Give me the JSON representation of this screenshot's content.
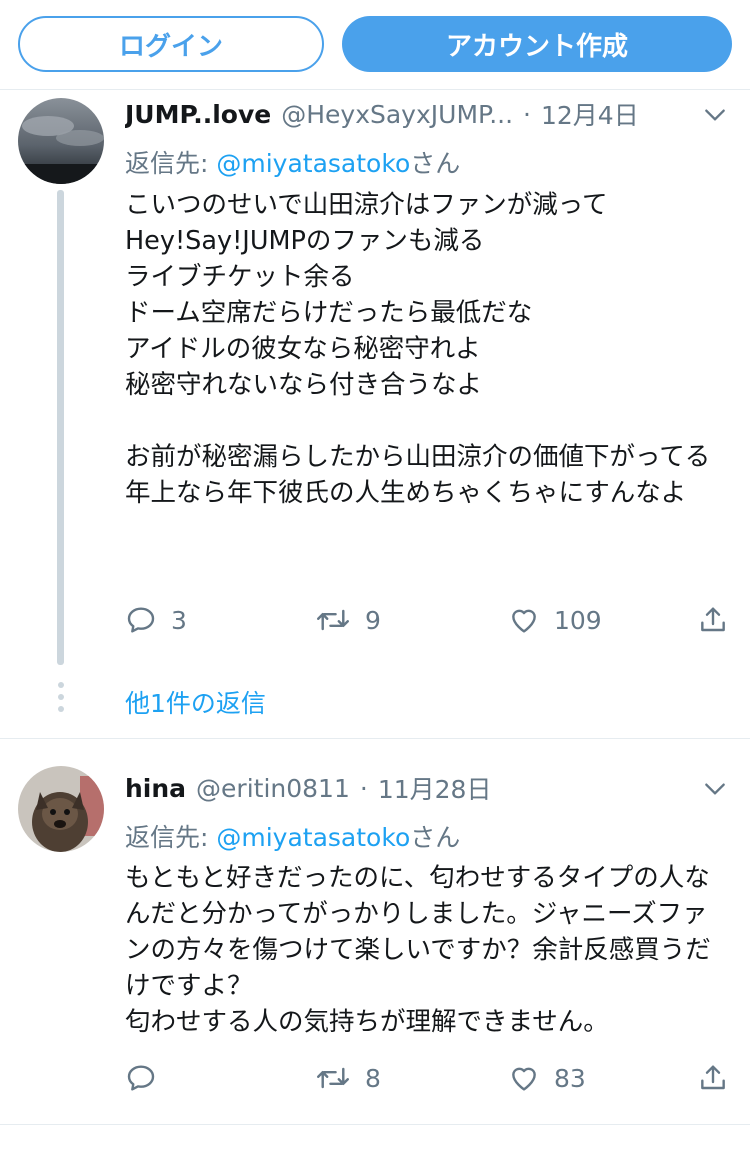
{
  "auth": {
    "login_label": "ログイン",
    "signup_label": "アカウント作成"
  },
  "tweets": [
    {
      "name": "JUMP..love",
      "handle": "@HeyxSayxJUMP...",
      "separator": "·",
      "date": "12月4日",
      "reply_prefix": "返信先: ",
      "reply_mention": "@miyatasatoko",
      "reply_suffix": "さん",
      "text": "こいつのせいで山田涼介はファンが減って\nHey!Say!JUMPのファンも減る\nライブチケット余る\nドーム空席だらけだったら最低だな\nアイドルの彼女なら秘密守れよ\n秘密守れないなら付き合うなよ\n\nお前が秘密漏らしたから山田涼介の価値下がってる\n年上なら年下彼氏の人生めちゃくちゃにすんなよ",
      "replies": "3",
      "retweets": "9",
      "likes": "109",
      "more_replies": "他1件の返信"
    },
    {
      "name": "hina",
      "handle": "@eritin0811",
      "separator": "·",
      "date": "11月28日",
      "reply_prefix": "返信先: ",
      "reply_mention": "@miyatasatoko",
      "reply_suffix": "さん",
      "text": "もともと好きだったのに、匂わせするタイプの人なんだと分かってがっかりしました。ジャニーズファンの方々を傷つけて楽しいですか？余計反感買うだけですよ？\n匂わせする人の気持ちが理解できません。",
      "replies": "",
      "retweets": "8",
      "likes": "83"
    }
  ],
  "icons": [
    "chevron-down-icon",
    "reply-icon",
    "retweet-icon",
    "like-icon",
    "share-icon"
  ],
  "colors": {
    "accent": "#4aa1eb",
    "link": "#1da1f2",
    "muted": "#657786"
  }
}
